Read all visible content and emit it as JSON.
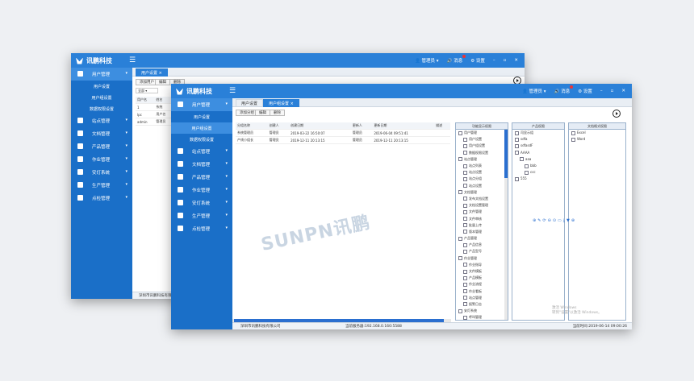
{
  "app": {
    "logo_text": "讯鹏科技",
    "admin": "管理员",
    "message": "消息",
    "settings": "设置",
    "minimize": "–",
    "restore": "▫",
    "close": "✕"
  },
  "sidebar": {
    "head": "用户管理",
    "subs": [
      "用户设置",
      "用户组设置",
      "数据权限设置"
    ],
    "items": [
      "站点管理",
      "文档管理",
      "产品管理",
      "作业管理",
      "安灯系统",
      "生产管理",
      "点检管理"
    ]
  },
  "back": {
    "tab": "用户设置",
    "buttons": [
      "添加用户",
      "编辑",
      "删除"
    ],
    "select_value": "全部",
    "columns": [
      "用户名",
      "姓名"
    ],
    "rows": [
      [
        "1",
        "系统"
      ],
      [
        "lpc",
        "用户名"
      ],
      [
        "admin",
        "管理员"
      ]
    ],
    "footer": "深圳市讯鹏科技有限"
  },
  "front": {
    "tabs": [
      "用户设置",
      "用户组设置"
    ],
    "buttons": [
      "添加分组",
      "编辑",
      "删除"
    ],
    "columns": [
      "分组名称",
      "创建人",
      "创建日期",
      "更新人",
      "更新日期",
      "描述"
    ],
    "rows": [
      [
        "系统管理员",
        "管理员",
        "2019-03-22 16:50:07",
        "管理员",
        "2019-06-04 09:51:41",
        ""
      ],
      [
        "产线小组长",
        "管理员",
        "2019-12-11 20:13:15",
        "管理员",
        "2019-12-11 20:13:15",
        ""
      ]
    ],
    "perm_panel": {
      "title": "功能显示权限",
      "nodes": [
        {
          "t": "用户管理",
          "d": 0
        },
        {
          "t": "用户设置",
          "d": 1
        },
        {
          "t": "用户组设置",
          "d": 1
        },
        {
          "t": "数据权限设置",
          "d": 1
        },
        {
          "t": "站点管理",
          "d": 0
        },
        {
          "t": "站点列表",
          "d": 1
        },
        {
          "t": "站点设置",
          "d": 1
        },
        {
          "t": "站点分组",
          "d": 1
        },
        {
          "t": "站点设置",
          "d": 1
        },
        {
          "t": "文档管理",
          "d": 0
        },
        {
          "t": "发布文档设置",
          "d": 1
        },
        {
          "t": "文档设置管理",
          "d": 1
        },
        {
          "t": "文件管理",
          "d": 1
        },
        {
          "t": "文件审核",
          "d": 1
        },
        {
          "t": "批量上传",
          "d": 1
        },
        {
          "t": "版本管理",
          "d": 1
        },
        {
          "t": "产品管理",
          "d": 0
        },
        {
          "t": "产品信息",
          "d": 1
        },
        {
          "t": "产品型号",
          "d": 1
        },
        {
          "t": "作业管理",
          "d": 0
        },
        {
          "t": "作业指导",
          "d": 1
        },
        {
          "t": "文件模板",
          "d": 1
        },
        {
          "t": "产品模板",
          "d": 1
        },
        {
          "t": "作业流程",
          "d": 1
        },
        {
          "t": "作业看板",
          "d": 1
        },
        {
          "t": "站点管理",
          "d": 1
        },
        {
          "t": "报警日志",
          "d": 1
        },
        {
          "t": "安灯系统",
          "d": 0
        },
        {
          "t": "呼叫管理",
          "d": 1
        },
        {
          "t": "呼叫看板",
          "d": 1
        },
        {
          "t": "呼叫报表",
          "d": 1
        },
        {
          "t": "呼叫看板",
          "d": 1
        },
        {
          "t": "报警日志",
          "d": 1
        }
      ]
    },
    "product_panel": {
      "title": "产品权限",
      "nodes": [
        {
          "t": "司显示组",
          "d": 0
        },
        {
          "t": "sdfa",
          "d": 0
        },
        {
          "t": "sdfasdF",
          "d": 0
        },
        {
          "t": "AAAA",
          "d": 0
        },
        {
          "t": "aaa",
          "d": 1
        },
        {
          "t": "bbb",
          "d": 2
        },
        {
          "t": "ccc",
          "d": 2
        },
        {
          "t": "555",
          "d": 0
        }
      ]
    },
    "doctype_panel": {
      "title": "文档格式权限",
      "nodes": [
        {
          "t": "Excel",
          "d": 0
        },
        {
          "t": "Word",
          "d": 0
        }
      ]
    },
    "tool_icons": [
      "⊕",
      "✎",
      "⟳",
      "⊖",
      "⊙",
      "▭",
      "⤓",
      "▼",
      "⊕"
    ],
    "status_left": "深圳市讯鹏科技有限公司",
    "status_mid": "当前服务器:192.168.0.160:5588",
    "status_right": "当前时间:2019-06-14 09:00:26"
  },
  "activate": [
    "激活 Windows",
    "转到\"设置\"以激活 Windows。"
  ],
  "watermark": "SUNPN讯鹏"
}
